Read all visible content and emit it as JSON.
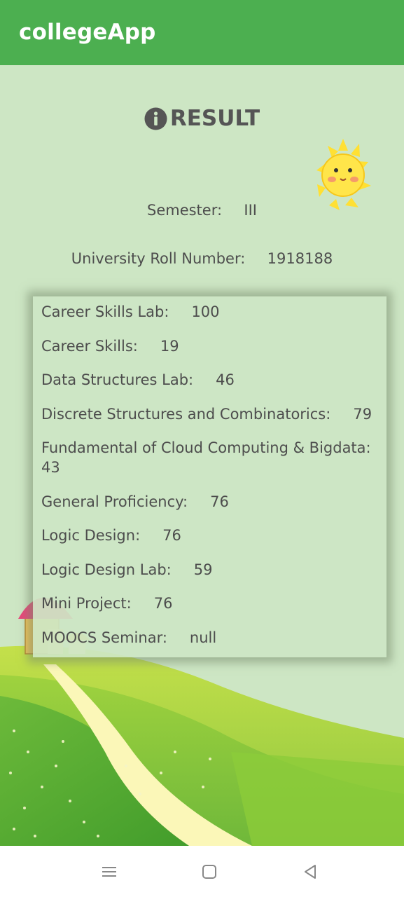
{
  "app": {
    "title": "collegeApp"
  },
  "result": {
    "heading": "RESULT"
  },
  "semester": {
    "label": "Semester:",
    "value": "III"
  },
  "roll": {
    "label": "University Roll Number:",
    "value": "1918188"
  },
  "subjects": [
    {
      "name": "Career Skills Lab:",
      "mark": "100"
    },
    {
      "name": "Career Skills:",
      "mark": "19"
    },
    {
      "name": "Data Structures Lab:",
      "mark": "46"
    },
    {
      "name": "Discrete Structures and Combinatorics:",
      "mark": "79"
    },
    {
      "name": "Fundamental of Cloud Computing & Bigdata:",
      "mark": "43"
    },
    {
      "name": "General Proficiency:",
      "mark": "76"
    },
    {
      "name": "Logic Design:",
      "mark": "76"
    },
    {
      "name": "Logic Design Lab:",
      "mark": "59"
    },
    {
      "name": "Mini Project:",
      "mark": "76"
    },
    {
      "name": "MOOCS Seminar:",
      "mark": "null"
    }
  ],
  "nav": {
    "menu_icon": "menu-icon",
    "home_icon": "home-icon",
    "back_icon": "back-icon"
  },
  "colors": {
    "appbar": "#4caf50",
    "background": "#cde6c4",
    "text": "#4d4d4d"
  }
}
